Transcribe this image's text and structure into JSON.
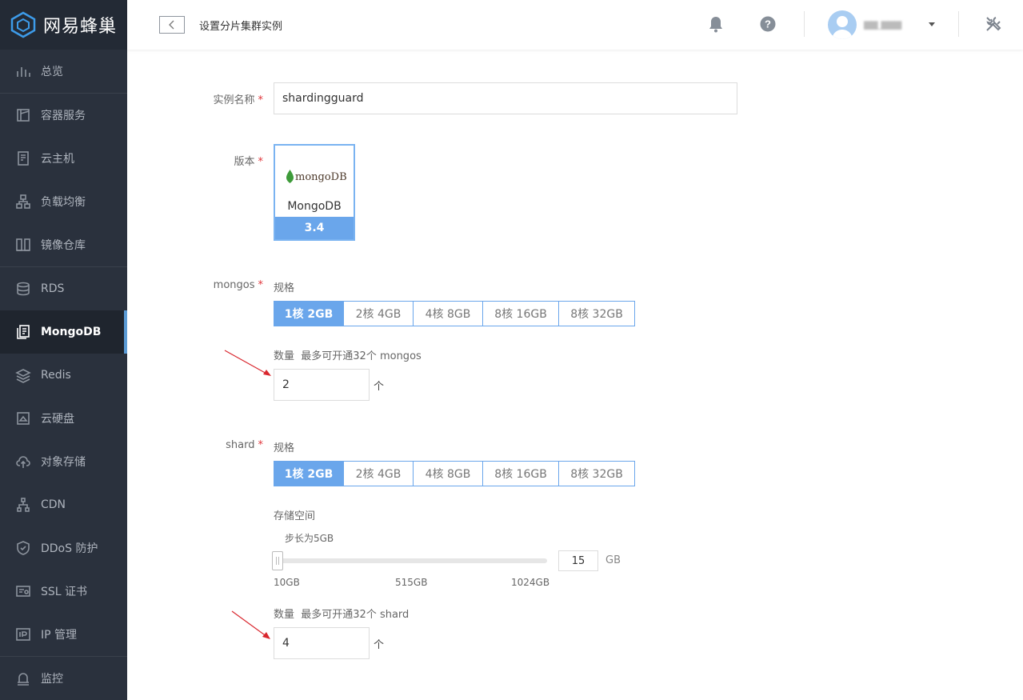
{
  "app": {
    "brand": "网易蜂巢"
  },
  "sidebar": {
    "items": [
      {
        "label": "总览",
        "icon": "bar-chart-icon"
      },
      {
        "label": "容器服务",
        "icon": "container-icon"
      },
      {
        "label": "云主机",
        "icon": "server-icon"
      },
      {
        "label": "负载均衡",
        "icon": "network-icon"
      },
      {
        "label": "镜像仓库",
        "icon": "repository-icon"
      },
      {
        "label": "RDS",
        "icon": "database-icon"
      },
      {
        "label": "MongoDB",
        "icon": "document-icon",
        "active": true
      },
      {
        "label": "Redis",
        "icon": "layers-icon"
      },
      {
        "label": "云硬盘",
        "icon": "disk-icon"
      },
      {
        "label": "对象存储",
        "icon": "cloud-upload-icon"
      },
      {
        "label": "CDN",
        "icon": "cdn-icon"
      },
      {
        "label": "DDoS 防护",
        "icon": "shield-icon"
      },
      {
        "label": "SSL 证书",
        "icon": "certificate-icon"
      },
      {
        "label": "IP 管理",
        "icon": "ip-icon"
      },
      {
        "label": "监控",
        "icon": "monitor-bell-icon"
      }
    ]
  },
  "header": {
    "title": "设置分片集群实例",
    "username": "▆▆_▆▆▆"
  },
  "form": {
    "instance_name": {
      "label": "实例名称",
      "value": "shardingguard"
    },
    "version": {
      "label": "版本",
      "logo_text": "mongoDB",
      "name": "MongoDB",
      "number": "3.4"
    },
    "mongos": {
      "label": "mongos",
      "spec_label": "规格",
      "specs": [
        "1核 2GB",
        "2核 4GB",
        "4核 8GB",
        "8核 16GB",
        "8核 32GB"
      ],
      "selected_spec": "1核 2GB",
      "count_label": "数量",
      "count_hint": "最多可开通32个 mongos",
      "count_value": "2",
      "count_unit": "个"
    },
    "shard": {
      "label": "shard",
      "spec_label": "规格",
      "specs": [
        "1核 2GB",
        "2核 4GB",
        "4核 8GB",
        "8核 16GB",
        "8核 32GB"
      ],
      "selected_spec": "1核 2GB",
      "storage_label": "存储空间",
      "storage_step": "步长为5GB",
      "storage_value": "15",
      "storage_unit": "GB",
      "storage_ticks": [
        "10GB",
        "515GB",
        "1024GB"
      ],
      "count_label": "数量",
      "count_hint": "最多可开通32个 shard",
      "count_value": "4",
      "count_unit": "个"
    }
  },
  "colors": {
    "sidebar_bg": "#2a313d",
    "accent": "#6aa6eb",
    "required": "#e0353b",
    "arrow": "#d9272e"
  }
}
